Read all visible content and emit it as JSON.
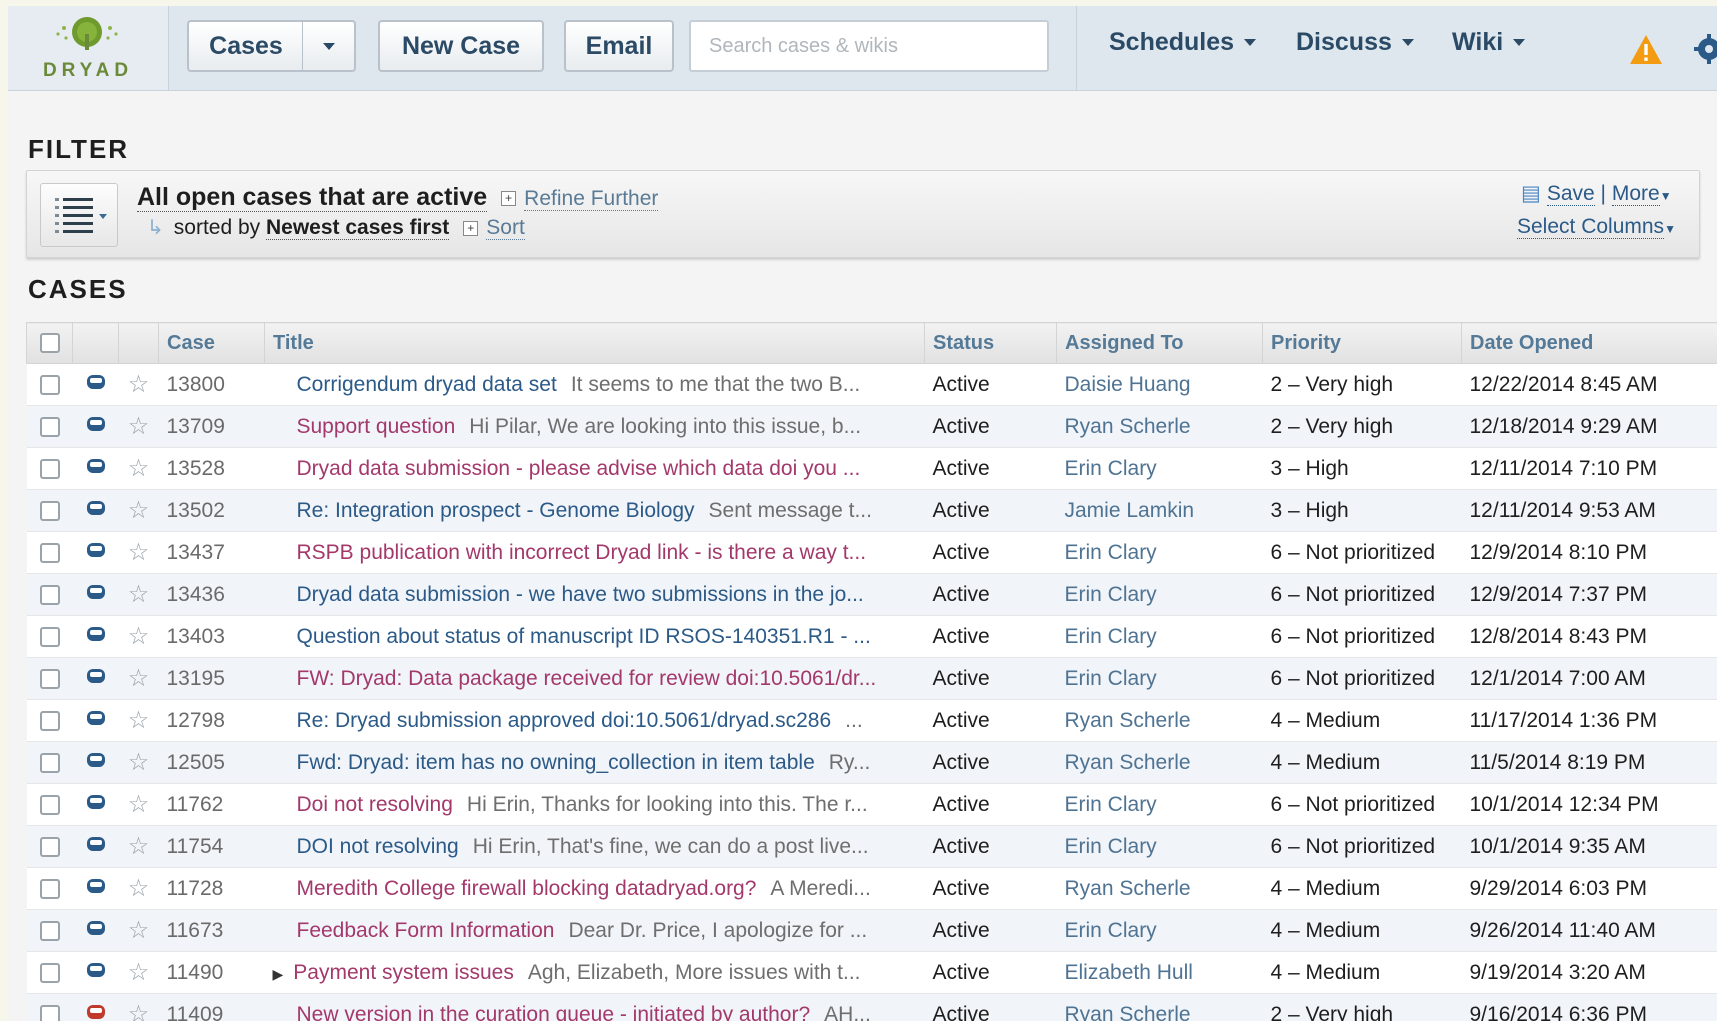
{
  "header": {
    "logo_text": "DRYAD",
    "cases_label": "Cases",
    "new_case_label": "New Case",
    "email_label": "Email",
    "search_placeholder": "Search cases & wikis",
    "nav": [
      "Schedules",
      "Discuss",
      "Wiki"
    ]
  },
  "filter": {
    "heading": "FILTER",
    "line1_bold": "All open cases that are active",
    "refine_label": "Refine Further",
    "line2_prefix": "sorted by",
    "line2_bold": "Newest cases first",
    "sort_label": "Sort",
    "save_label": "Save",
    "more_label": "More",
    "select_columns_label": "Select Columns"
  },
  "cases": {
    "heading": "CASES",
    "columns": [
      "Case",
      "Title",
      "Status",
      "Assigned To",
      "Priority",
      "Date Opened"
    ],
    "rows": [
      {
        "case": "13800",
        "title": "Corrigendum dryad data set",
        "preview": "It seems to me that the two B...",
        "status": "Active",
        "assigned": "Daisie Huang",
        "priority": "2 – Very high",
        "date": "12/22/2014 8:45 AM",
        "tc": "blue",
        "icon": "blue"
      },
      {
        "case": "13709",
        "title": "Support question",
        "preview": "Hi Pilar,  We are looking into this issue, b...",
        "status": "Active",
        "assigned": "Ryan Scherle",
        "priority": "2 – Very high",
        "date": "12/18/2014 9:29 AM",
        "tc": "pink",
        "icon": "blue"
      },
      {
        "case": "13528",
        "title": "Dryad data submission - please advise which data doi you ...",
        "preview": "",
        "status": "Active",
        "assigned": "Erin Clary",
        "priority": "3 – High",
        "date": "12/11/2014 7:10 PM",
        "tc": "pink",
        "icon": "blue"
      },
      {
        "case": "13502",
        "title": "Re: Integration prospect - Genome Biology",
        "preview": "Sent message t...",
        "status": "Active",
        "assigned": "Jamie Lamkin",
        "priority": "3 – High",
        "date": "12/11/2014 9:53 AM",
        "tc": "blue",
        "icon": "blue"
      },
      {
        "case": "13437",
        "title": "RSPB publication with incorrect Dryad link - is there a way t...",
        "preview": "",
        "status": "Active",
        "assigned": "Erin Clary",
        "priority": "6 – Not prioritized",
        "date": "12/9/2014 8:10 PM",
        "tc": "pink",
        "icon": "blue"
      },
      {
        "case": "13436",
        "title": "Dryad data submission - we have two submissions in the jo...",
        "preview": "",
        "status": "Active",
        "assigned": "Erin Clary",
        "priority": "6 – Not prioritized",
        "date": "12/9/2014 7:37 PM",
        "tc": "blue",
        "icon": "blue"
      },
      {
        "case": "13403",
        "title": "Question about status of manuscript ID RSOS-140351.R1 - ...",
        "preview": "",
        "status": "Active",
        "assigned": "Erin Clary",
        "priority": "6 – Not prioritized",
        "date": "12/8/2014 8:43 PM",
        "tc": "blue",
        "icon": "blue"
      },
      {
        "case": "13195",
        "title": "FW: Dryad: Data package received for review doi:10.5061/dr...",
        "preview": "",
        "status": "Active",
        "assigned": "Erin Clary",
        "priority": "6 – Not prioritized",
        "date": "12/1/2014 7:00 AM",
        "tc": "pink",
        "icon": "blue"
      },
      {
        "case": "12798",
        "title": "Re: Dryad submission approved doi:10.5061/dryad.sc286",
        "preview": "...",
        "status": "Active",
        "assigned": "Ryan Scherle",
        "priority": "4 – Medium",
        "date": "11/17/2014 1:36 PM",
        "tc": "blue",
        "icon": "blue"
      },
      {
        "case": "12505",
        "title": "Fwd: Dryad: item has no owning_collection in item table",
        "preview": "Ry...",
        "status": "Active",
        "assigned": "Ryan Scherle",
        "priority": "4 – Medium",
        "date": "11/5/2014 8:19 PM",
        "tc": "blue",
        "icon": "blue"
      },
      {
        "case": "11762",
        "title": "Doi not resolving",
        "preview": "Hi Erin,  Thanks for looking into this. The r...",
        "status": "Active",
        "assigned": "Erin Clary",
        "priority": "6 – Not prioritized",
        "date": "10/1/2014 12:34 PM",
        "tc": "pink",
        "icon": "blue"
      },
      {
        "case": "11754",
        "title": "DOI not resolving",
        "preview": "Hi Erin,  That's fine, we can do a post live...",
        "status": "Active",
        "assigned": "Erin Clary",
        "priority": "6 – Not prioritized",
        "date": "10/1/2014 9:35 AM",
        "tc": "blue",
        "icon": "blue"
      },
      {
        "case": "11728",
        "title": "Meredith College firewall blocking datadryad.org?",
        "preview": "A Meredi...",
        "status": "Active",
        "assigned": "Ryan Scherle",
        "priority": "4 – Medium",
        "date": "9/29/2014 6:03 PM",
        "tc": "pink",
        "icon": "blue"
      },
      {
        "case": "11673",
        "title": "Feedback Form Information",
        "preview": "Dear Dr. Price,  I apologize for ...",
        "status": "Active",
        "assigned": "Erin Clary",
        "priority": "4 – Medium",
        "date": "9/26/2014 11:40 AM",
        "tc": "pink",
        "icon": "blue"
      },
      {
        "case": "11490",
        "title": "Payment system issues",
        "preview": "Agh, Elizabeth,  More issues with t...",
        "status": "Active",
        "assigned": "Elizabeth Hull",
        "priority": "4 – Medium",
        "date": "9/19/2014 3:20 AM",
        "tc": "pink",
        "icon": "blue",
        "expand": true
      },
      {
        "case": "11409",
        "title": "New version in the curation queue - initiated by author?",
        "preview": "AH...",
        "status": "Active",
        "assigned": "Ryan Scherle",
        "priority": "2 – Very high",
        "date": "9/16/2014 6:36 PM",
        "tc": "pink",
        "icon": "red"
      }
    ]
  },
  "colors": {
    "accent": "#2b4a66",
    "link_pink": "#a3386b",
    "link_blue": "#2b5a88",
    "warning": "#f39c12"
  }
}
